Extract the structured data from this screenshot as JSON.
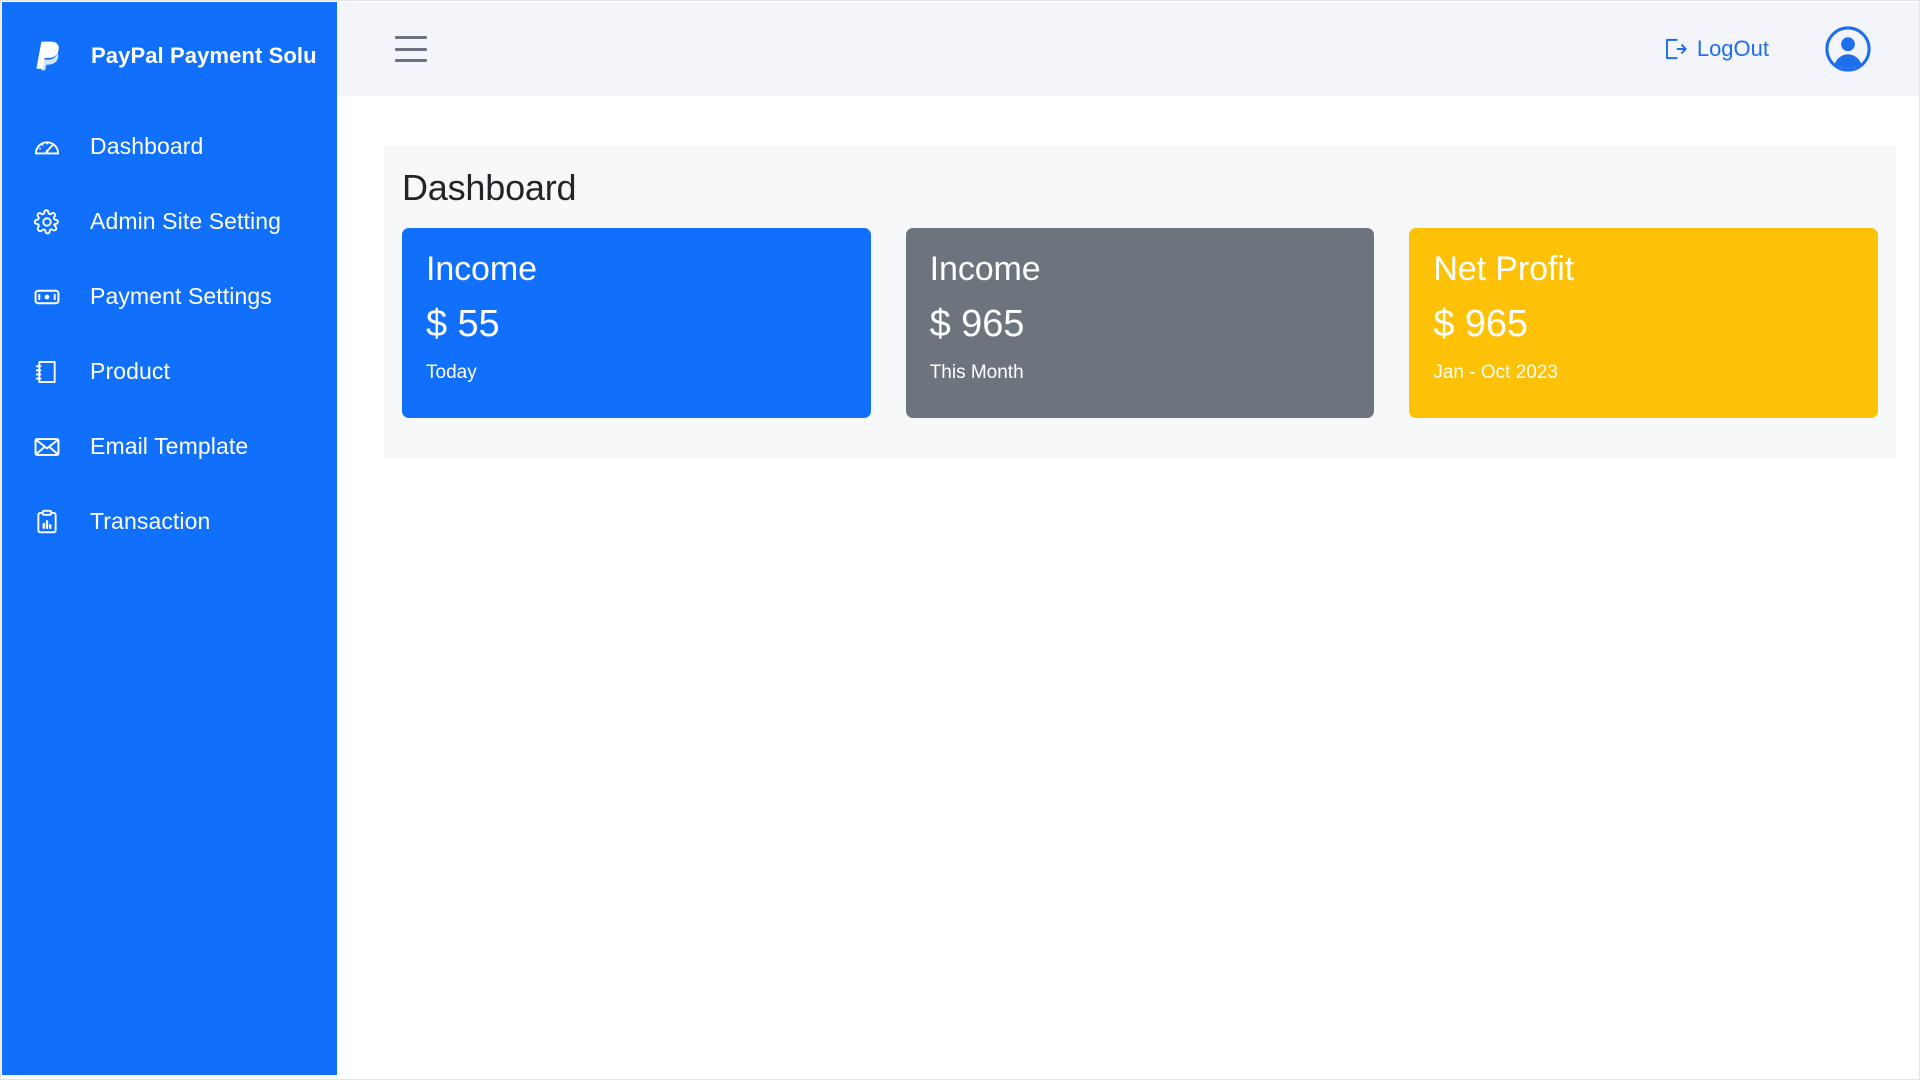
{
  "brand": {
    "logo_icon": "paypal-logo-icon",
    "title": "PayPal Payment Solu"
  },
  "sidebar": {
    "background_color": "#1070fb",
    "items": [
      {
        "label": "Dashboard",
        "icon": "speedometer-icon"
      },
      {
        "label": "Admin Site Setting",
        "icon": "gear-icon"
      },
      {
        "label": "Payment Settings",
        "icon": "banknote-icon"
      },
      {
        "label": "Product",
        "icon": "notebook-icon"
      },
      {
        "label": "Email Template",
        "icon": "envelope-icon"
      },
      {
        "label": "Transaction",
        "icon": "clipboard-chart-icon"
      }
    ]
  },
  "topbar": {
    "menu_toggle_icon": "hamburger-icon",
    "logout_label": "LogOut",
    "logout_icon": "logout-arrow-icon",
    "avatar_icon": "user-avatar-icon",
    "accent_color": "#1f6fec",
    "background_color": "#f4f5fa"
  },
  "main": {
    "page_title": "Dashboard",
    "cards": [
      {
        "title": "Income",
        "value": "$ 55",
        "period": "Today",
        "color": "#1070fb"
      },
      {
        "title": "Income",
        "value": "$ 965",
        "period": "This Month",
        "color": "#6c757d"
      },
      {
        "title": "Net Profit",
        "value": "$ 965",
        "period": "Jan - Oct 2023",
        "color": "#fdc208"
      }
    ]
  }
}
